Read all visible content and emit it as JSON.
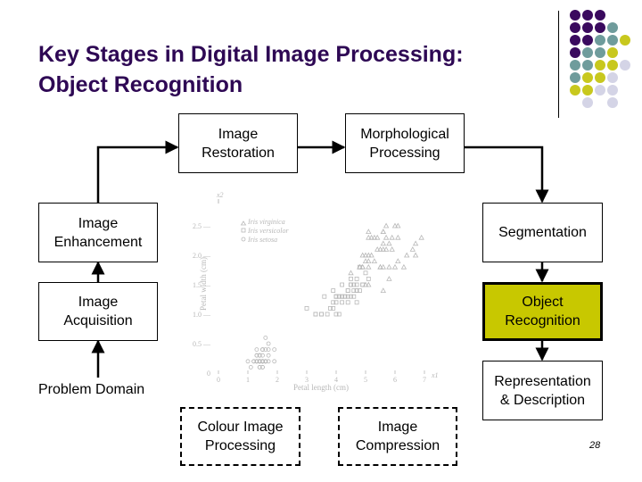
{
  "slide": {
    "title_line1": "Key Stages in Digital Image Processing:",
    "title_line2": "Object Recognition",
    "page_number": "28",
    "colors": {
      "title": "#2e0854",
      "highlight_fill": "#c8c800",
      "dot_purple": "#3a0a5e",
      "dot_teal": "#6f9c9c",
      "dot_yellow": "#c8c81e",
      "dot_lavender": "#d4d4e6"
    },
    "decor_dots": [
      [
        "P",
        "P",
        "P",
        "-",
        "-"
      ],
      [
        "P",
        "P",
        "P",
        "T",
        "-"
      ],
      [
        "P",
        "P",
        "T",
        "T",
        "Y"
      ],
      [
        "P",
        "T",
        "T",
        "Y",
        "-"
      ],
      [
        "T",
        "T",
        "Y",
        "Y",
        "L"
      ],
      [
        "T",
        "Y",
        "Y",
        "L",
        "-"
      ],
      [
        "Y",
        "Y",
        "L",
        "L",
        "-"
      ],
      [
        "-",
        "L",
        "-",
        "L",
        "-"
      ]
    ]
  },
  "stages": {
    "image_restoration": "Image\nRestoration",
    "morphological_processing": "Morphological\nProcessing",
    "image_enhancement": "Image\nEnhancement",
    "segmentation": "Segmentation",
    "image_acquisition": "Image\nAcquisition",
    "object_recognition": "Object\nRecognition",
    "representation_description": "Representation\n& Description",
    "colour_image_processing": "Colour Image\nProcessing",
    "image_compression": "Image\nCompression",
    "problem_domain": "Problem Domain"
  },
  "chart_data": {
    "type": "scatter",
    "title": "",
    "xlabel": "Petal length (cm)",
    "ylabel": "Petal width (cm)",
    "x_axis_name": "x1",
    "y_axis_name": "x2",
    "xlim": [
      0,
      7
    ],
    "ylim": [
      0,
      2.5
    ],
    "x_ticks": [
      "0",
      "1",
      "2",
      "3",
      "4",
      "5",
      "6",
      "7"
    ],
    "y_ticks": [
      "0",
      "0.5",
      "1.0",
      "1.5",
      "2.0",
      "2.5"
    ],
    "legend": [
      "Iris virginica",
      "Iris versicolor",
      "Iris setosa"
    ],
    "legend_position": "top-left",
    "series": [
      {
        "name": "Iris virginica",
        "marker": "triangle",
        "points": [
          [
            6.0,
            2.5
          ],
          [
            5.1,
            1.9
          ],
          [
            5.9,
            2.1
          ],
          [
            5.6,
            1.8
          ],
          [
            5.8,
            2.2
          ],
          [
            6.6,
            2.1
          ],
          [
            4.5,
            1.7
          ],
          [
            6.3,
            1.8
          ],
          [
            5.8,
            1.8
          ],
          [
            6.1,
            2.5
          ],
          [
            5.1,
            2.0
          ],
          [
            5.3,
            1.9
          ],
          [
            5.5,
            2.1
          ],
          [
            5.0,
            2.0
          ],
          [
            5.1,
            2.4
          ],
          [
            5.3,
            2.3
          ],
          [
            5.5,
            1.8
          ],
          [
            6.7,
            2.2
          ],
          [
            6.9,
            2.3
          ],
          [
            5.0,
            1.5
          ],
          [
            5.7,
            2.3
          ],
          [
            4.9,
            2.0
          ],
          [
            6.7,
            2.0
          ],
          [
            4.9,
            1.8
          ],
          [
            5.7,
            2.1
          ],
          [
            6.0,
            1.8
          ],
          [
            4.8,
            1.8
          ],
          [
            4.9,
            1.8
          ],
          [
            5.6,
            2.1
          ],
          [
            5.8,
            1.6
          ],
          [
            6.1,
            1.9
          ],
          [
            6.4,
            2.0
          ],
          [
            5.6,
            2.2
          ],
          [
            5.1,
            1.5
          ],
          [
            5.6,
            1.4
          ],
          [
            6.1,
            2.3
          ],
          [
            5.6,
            2.4
          ],
          [
            5.5,
            1.8
          ],
          [
            4.8,
            1.8
          ],
          [
            5.4,
            2.1
          ],
          [
            5.6,
            2.4
          ],
          [
            5.1,
            2.3
          ],
          [
            5.9,
            2.3
          ],
          [
            5.7,
            2.5
          ],
          [
            5.2,
            2.3
          ],
          [
            5.0,
            1.9
          ],
          [
            5.2,
            2.0
          ],
          [
            5.4,
            2.3
          ],
          [
            5.1,
            1.8
          ]
        ]
      },
      {
        "name": "Iris versicolor",
        "marker": "square",
        "points": [
          [
            4.7,
            1.4
          ],
          [
            4.5,
            1.5
          ],
          [
            4.9,
            1.5
          ],
          [
            4.0,
            1.3
          ],
          [
            4.6,
            1.5
          ],
          [
            4.5,
            1.3
          ],
          [
            4.7,
            1.6
          ],
          [
            3.3,
            1.0
          ],
          [
            4.6,
            1.3
          ],
          [
            3.9,
            1.4
          ],
          [
            3.5,
            1.0
          ],
          [
            4.2,
            1.5
          ],
          [
            4.0,
            1.0
          ],
          [
            4.7,
            1.4
          ],
          [
            3.6,
            1.3
          ],
          [
            4.4,
            1.4
          ],
          [
            4.5,
            1.5
          ],
          [
            4.1,
            1.0
          ],
          [
            4.5,
            1.5
          ],
          [
            3.9,
            1.1
          ],
          [
            4.8,
            1.8
          ],
          [
            4.0,
            1.3
          ],
          [
            4.9,
            1.5
          ],
          [
            4.7,
            1.2
          ],
          [
            4.3,
            1.3
          ],
          [
            4.4,
            1.4
          ],
          [
            4.8,
            1.4
          ],
          [
            5.0,
            1.7
          ],
          [
            4.5,
            1.5
          ],
          [
            3.5,
            1.0
          ],
          [
            3.8,
            1.1
          ],
          [
            3.7,
            1.0
          ],
          [
            3.9,
            1.2
          ],
          [
            5.1,
            1.6
          ],
          [
            4.5,
            1.5
          ],
          [
            4.5,
            1.6
          ],
          [
            4.7,
            1.5
          ],
          [
            4.4,
            1.3
          ],
          [
            4.1,
            1.3
          ],
          [
            4.0,
            1.3
          ],
          [
            4.4,
            1.2
          ],
          [
            4.6,
            1.4
          ],
          [
            4.0,
            1.2
          ],
          [
            3.3,
            1.0
          ],
          [
            4.2,
            1.3
          ],
          [
            4.2,
            1.2
          ],
          [
            4.2,
            1.3
          ],
          [
            4.3,
            1.3
          ],
          [
            3.0,
            1.1
          ],
          [
            4.1,
            1.3
          ]
        ]
      },
      {
        "name": "Iris setosa",
        "marker": "circle",
        "points": [
          [
            1.4,
            0.2
          ],
          [
            1.4,
            0.2
          ],
          [
            1.3,
            0.2
          ],
          [
            1.5,
            0.2
          ],
          [
            1.4,
            0.2
          ],
          [
            1.7,
            0.4
          ],
          [
            1.4,
            0.3
          ],
          [
            1.5,
            0.2
          ],
          [
            1.4,
            0.2
          ],
          [
            1.5,
            0.1
          ],
          [
            1.5,
            0.2
          ],
          [
            1.6,
            0.2
          ],
          [
            1.4,
            0.1
          ],
          [
            1.1,
            0.1
          ],
          [
            1.2,
            0.2
          ],
          [
            1.5,
            0.4
          ],
          [
            1.3,
            0.4
          ],
          [
            1.4,
            0.3
          ],
          [
            1.7,
            0.3
          ],
          [
            1.5,
            0.3
          ],
          [
            1.7,
            0.2
          ],
          [
            1.5,
            0.4
          ],
          [
            1.0,
            0.2
          ],
          [
            1.7,
            0.5
          ],
          [
            1.9,
            0.2
          ],
          [
            1.6,
            0.2
          ],
          [
            1.6,
            0.4
          ],
          [
            1.5,
            0.2
          ],
          [
            1.4,
            0.2
          ],
          [
            1.6,
            0.2
          ],
          [
            1.6,
            0.2
          ],
          [
            1.5,
            0.4
          ],
          [
            1.5,
            0.1
          ],
          [
            1.4,
            0.2
          ],
          [
            1.5,
            0.2
          ],
          [
            1.2,
            0.2
          ],
          [
            1.3,
            0.2
          ],
          [
            1.4,
            0.1
          ],
          [
            1.3,
            0.2
          ],
          [
            1.5,
            0.2
          ],
          [
            1.3,
            0.3
          ],
          [
            1.3,
            0.3
          ],
          [
            1.3,
            0.2
          ],
          [
            1.6,
            0.6
          ],
          [
            1.9,
            0.4
          ],
          [
            1.4,
            0.3
          ],
          [
            1.6,
            0.2
          ],
          [
            1.4,
            0.2
          ],
          [
            1.5,
            0.2
          ],
          [
            1.4,
            0.2
          ]
        ]
      }
    ]
  }
}
